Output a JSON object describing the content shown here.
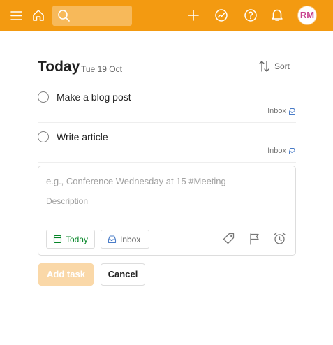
{
  "colors": {
    "topbar": "#f39a11",
    "accent": "#f39a11",
    "today_green": "#058527",
    "avatar_text": "#c7418e"
  },
  "topbar": {
    "icons": [
      "menu-icon",
      "home-icon",
      "search-icon",
      "plus-icon",
      "productivity-icon",
      "help-icon",
      "bell-icon"
    ],
    "avatar_initials": "RM"
  },
  "header": {
    "title": "Today",
    "date": "Tue 19 Oct",
    "sort_label": "Sort"
  },
  "tasks": [
    {
      "text": "Make a blog post",
      "project": "Inbox"
    },
    {
      "text": "Write article",
      "project": "Inbox"
    }
  ],
  "editor": {
    "task_placeholder": "e.g., Conference Wednesday at 15 #Meeting",
    "description_placeholder": "Description",
    "due_label": "Today",
    "project_label": "Inbox"
  },
  "actions": {
    "add_label": "Add task",
    "cancel_label": "Cancel"
  }
}
